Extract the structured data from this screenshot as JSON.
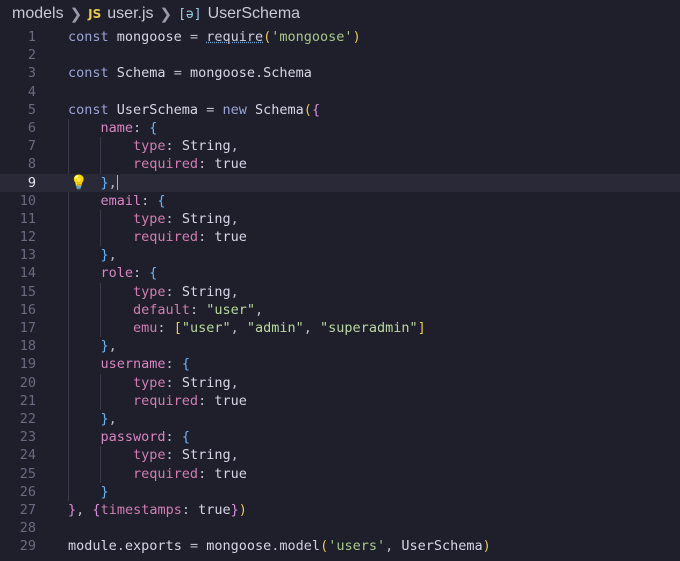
{
  "breadcrumb": {
    "folder": "models",
    "file_icon": "JS",
    "file": "user.js",
    "symbol": "UserSchema"
  },
  "editor": {
    "active_line": 9,
    "line_numbers": [
      "1",
      "2",
      "3",
      "4",
      "5",
      "6",
      "7",
      "8",
      "9",
      "10",
      "11",
      "12",
      "13",
      "14",
      "15",
      "16",
      "17",
      "18",
      "19",
      "20",
      "21",
      "22",
      "23",
      "24",
      "25",
      "26",
      "27",
      "28",
      "29"
    ],
    "code": {
      "l1": {
        "kw": "const",
        "name": "mongoose",
        "eq": "=",
        "fn": "require",
        "open": "(",
        "arg": "'mongoose'",
        "close": ")"
      },
      "l3": {
        "kw": "const",
        "name": "Schema",
        "eq": "=",
        "obj": "mongoose",
        "dot": ".",
        "prop": "Schema"
      },
      "l5": {
        "kw": "const",
        "name": "UserSchema",
        "eq": "=",
        "new": "new",
        "cls": "Schema",
        "open": "(",
        "brace": "{"
      },
      "name_key": "name",
      "email_key": "email",
      "role_key": "role",
      "username_key": "username",
      "password_key": "password",
      "type_key": "type",
      "type_val": "String",
      "required_key": "required",
      "required_val": "true",
      "default_key": "default",
      "default_val": "\"user\"",
      "emu_key": "emu",
      "emu_v1": "\"user\"",
      "emu_v2": "\"admin\"",
      "emu_v3": "\"superadmin\"",
      "l27": {
        "close_brace": "}",
        "comma": ",",
        "opts_open": "{",
        "opts_key": "timestamps",
        "opts_val": "true",
        "opts_close": "}",
        "paren": ")"
      },
      "l29": {
        "obj": "module",
        "dot": ".",
        "prop": "exports",
        "eq": "=",
        "obj2": "mongoose",
        "dot2": ".",
        "fn": "model",
        "open": "(",
        "arg1": "'users'",
        "comma": ",",
        "arg2": "UserSchema",
        "close": ")"
      }
    },
    "icons": {
      "hint": "lightbulb-icon",
      "symbol": "symbol-variable-icon"
    },
    "colors": {
      "background": "#1f1e2b",
      "keyword": "#9aa4d6",
      "property": "#cf7fb3",
      "string": "#a8c98a",
      "bracket1": "#e8c84f",
      "bracket2": "#d68fdc",
      "bracket3": "#6fb3ef"
    }
  }
}
